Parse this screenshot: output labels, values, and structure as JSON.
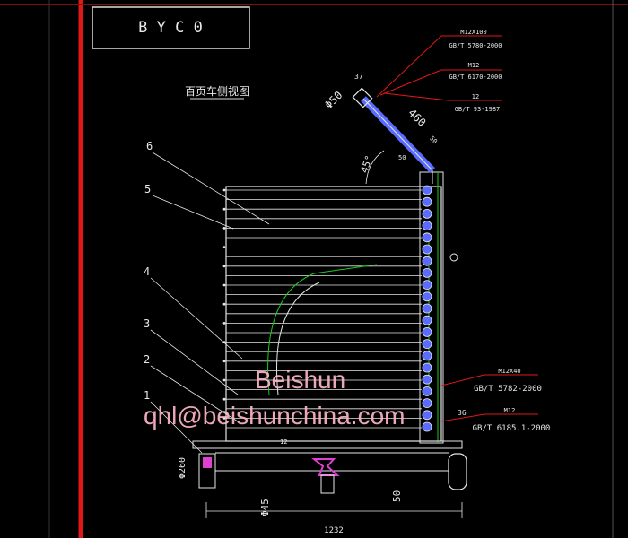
{
  "title_box": {
    "text": "B Y C 0"
  },
  "view_title": "百页车侧视图",
  "part_numbers": [
    "6",
    "5",
    "4",
    "3",
    "2",
    "1"
  ],
  "top_callouts": [
    {
      "spec": "M12X100",
      "standard": "GB/T 5780-2000"
    },
    {
      "spec": "M12",
      "standard": "GB/T 6170-2000"
    },
    {
      "spec": "12",
      "standard": "GB/T 93-1987"
    }
  ],
  "bottom_callouts": [
    {
      "spec": "M12X40",
      "standard": "GB/T 5782-2000"
    },
    {
      "spec": "M12",
      "standard": "GB/T 6185.1-2000"
    }
  ],
  "dimensions": {
    "d50": "Φ50",
    "d37": "37",
    "d460": "460",
    "d50b": "50",
    "d50c": "50",
    "angle": "45°",
    "d12": "12",
    "d36": "36",
    "d260": "Φ260",
    "d45": "Φ45",
    "d50bottom": "50",
    "width": "1232"
  },
  "watermark": {
    "brand": "Beishun",
    "email": "qhl@beishunchina.com"
  },
  "colors": {
    "background": "#000000",
    "border_red": "#e01818",
    "line_white": "#e6e6e6",
    "slat_blue": "#5a6cff",
    "green": "#1ec81e",
    "magenta": "#e040d0",
    "watermark": "#ffb6c8"
  }
}
